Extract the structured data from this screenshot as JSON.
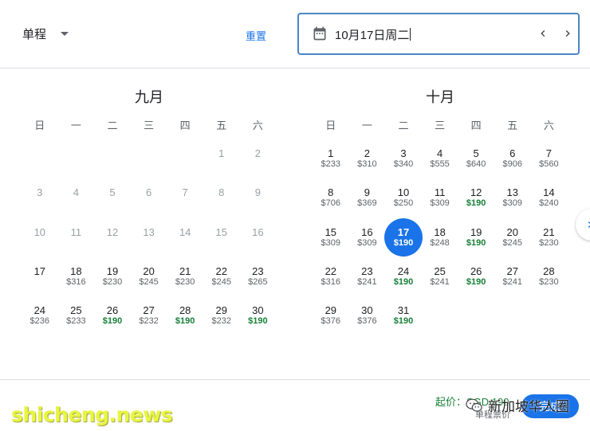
{
  "header": {
    "trip_type": "单程",
    "reset_label": "重置",
    "date_value": "10月17日周二"
  },
  "weekdays": [
    "日",
    "一",
    "二",
    "三",
    "四",
    "五",
    "六"
  ],
  "months": [
    {
      "title": "九月",
      "leading_blanks": 5,
      "days": [
        {
          "d": "1",
          "p": "",
          "past": true
        },
        {
          "d": "2",
          "p": "",
          "past": true
        },
        {
          "d": "3",
          "p": "",
          "past": true
        },
        {
          "d": "4",
          "p": "",
          "past": true
        },
        {
          "d": "5",
          "p": "",
          "past": true
        },
        {
          "d": "6",
          "p": "",
          "past": true
        },
        {
          "d": "7",
          "p": "",
          "past": true
        },
        {
          "d": "8",
          "p": "",
          "past": true
        },
        {
          "d": "9",
          "p": "",
          "past": true
        },
        {
          "d": "10",
          "p": "",
          "past": true
        },
        {
          "d": "11",
          "p": "",
          "past": true
        },
        {
          "d": "12",
          "p": "",
          "past": true
        },
        {
          "d": "13",
          "p": "",
          "past": true
        },
        {
          "d": "14",
          "p": "",
          "past": true
        },
        {
          "d": "15",
          "p": "",
          "past": true
        },
        {
          "d": "16",
          "p": "",
          "past": true
        },
        {
          "d": "17",
          "p": ""
        },
        {
          "d": "18",
          "p": "$316"
        },
        {
          "d": "19",
          "p": "$230"
        },
        {
          "d": "20",
          "p": "$245"
        },
        {
          "d": "21",
          "p": "$230"
        },
        {
          "d": "22",
          "p": "$245"
        },
        {
          "d": "23",
          "p": "$265"
        },
        {
          "d": "24",
          "p": "$236"
        },
        {
          "d": "25",
          "p": "$233"
        },
        {
          "d": "26",
          "p": "$190",
          "cheap": true
        },
        {
          "d": "27",
          "p": "$232"
        },
        {
          "d": "28",
          "p": "$190",
          "cheap": true
        },
        {
          "d": "29",
          "p": "$232"
        },
        {
          "d": "30",
          "p": "$190",
          "cheap": true
        }
      ]
    },
    {
      "title": "十月",
      "leading_blanks": 0,
      "days": [
        {
          "d": "1",
          "p": "$233"
        },
        {
          "d": "2",
          "p": "$310"
        },
        {
          "d": "3",
          "p": "$340"
        },
        {
          "d": "4",
          "p": "$555"
        },
        {
          "d": "5",
          "p": "$640"
        },
        {
          "d": "6",
          "p": "$906"
        },
        {
          "d": "7",
          "p": "$560"
        },
        {
          "d": "8",
          "p": "$706"
        },
        {
          "d": "9",
          "p": "$369"
        },
        {
          "d": "10",
          "p": "$250"
        },
        {
          "d": "11",
          "p": "$309"
        },
        {
          "d": "12",
          "p": "$190",
          "cheap": true
        },
        {
          "d": "13",
          "p": "$309"
        },
        {
          "d": "14",
          "p": "$240"
        },
        {
          "d": "15",
          "p": "$309"
        },
        {
          "d": "16",
          "p": "$309"
        },
        {
          "d": "17",
          "p": "$190",
          "selected": true
        },
        {
          "d": "18",
          "p": "$248"
        },
        {
          "d": "19",
          "p": "$190",
          "cheap": true
        },
        {
          "d": "20",
          "p": "$245"
        },
        {
          "d": "21",
          "p": "$230"
        },
        {
          "d": "22",
          "p": "$316"
        },
        {
          "d": "23",
          "p": "$241"
        },
        {
          "d": "24",
          "p": "$190",
          "cheap": true
        },
        {
          "d": "25",
          "p": "$241"
        },
        {
          "d": "26",
          "p": "$190",
          "cheap": true
        },
        {
          "d": "27",
          "p": "$241"
        },
        {
          "d": "28",
          "p": "$230"
        },
        {
          "d": "29",
          "p": "$376"
        },
        {
          "d": "30",
          "p": "$376"
        },
        {
          "d": "31",
          "p": "$190",
          "cheap": true
        }
      ]
    }
  ],
  "footer": {
    "from_price": "起价：SGD 190",
    "from_sub": "单程票价",
    "done_label": "完成"
  },
  "watermark": {
    "site": "shicheng.news",
    "brand": "新加坡华人圈"
  },
  "colors": {
    "accent": "#1a73e8",
    "cheap": "#188038",
    "focus_border": "#4a86c5"
  }
}
